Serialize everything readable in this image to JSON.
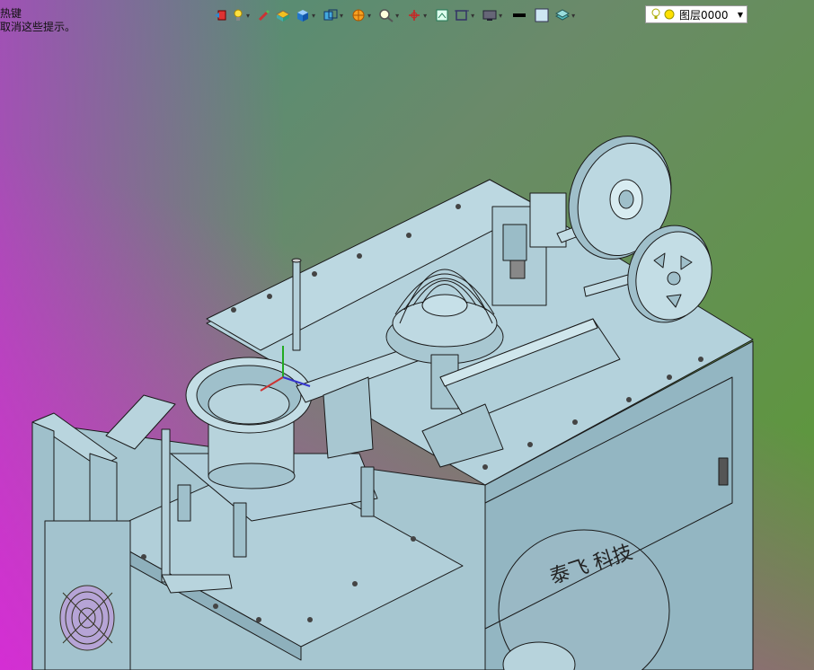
{
  "hint": {
    "line1": "热键",
    "line2": "取消这些提示。"
  },
  "toolbar": {
    "items": [
      {
        "name": "back-icon",
        "caret": false
      },
      {
        "name": "bulb-icon",
        "caret": true
      },
      {
        "name": "brush-icon",
        "caret": false
      },
      {
        "name": "box-material-icon",
        "caret": false
      },
      {
        "name": "cube-icon",
        "caret": true
      },
      {
        "name": "view-cube-icon",
        "caret": true
      },
      {
        "name": "render-sphere-icon",
        "caret": true
      },
      {
        "name": "zoom-icon",
        "caret": true
      },
      {
        "name": "axis-icon",
        "caret": true
      },
      {
        "name": "section-icon",
        "caret": false
      },
      {
        "name": "frame-icon",
        "caret": true
      },
      {
        "name": "display-icon",
        "caret": true
      },
      {
        "name": "line-weight-icon",
        "caret": false
      },
      {
        "name": "color-square-icon",
        "caret": false
      },
      {
        "name": "layer-stack-icon",
        "caret": true
      }
    ]
  },
  "layer": {
    "label": "图层0000"
  },
  "colors": {
    "machine": "#a9c9d3",
    "machine_dark": "#7fa3b0",
    "line": "#1a1a1a"
  },
  "machine": {
    "brand_text": "泰飞 科技"
  }
}
